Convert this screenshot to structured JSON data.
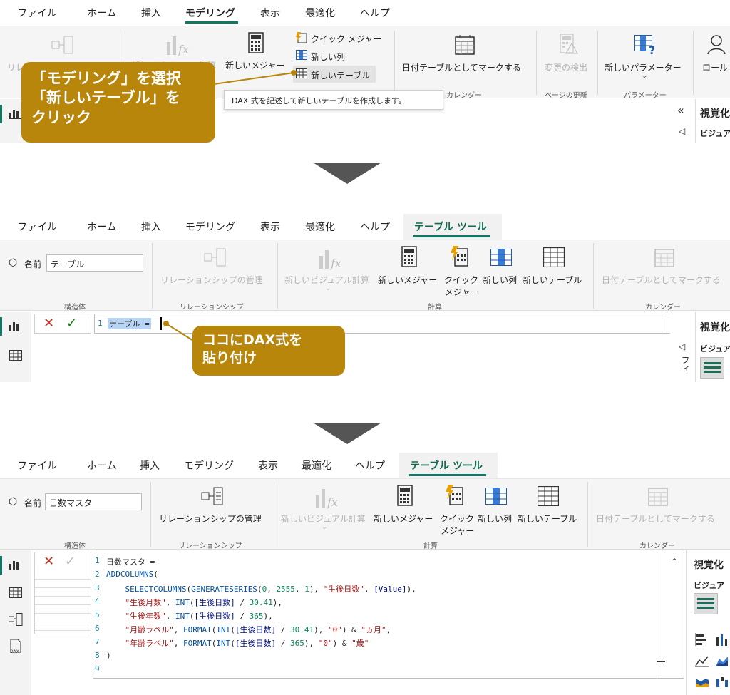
{
  "tabs_1": [
    "ファイル",
    "ホーム",
    "挿入",
    "モデリング",
    "表示",
    "最適化",
    "ヘルプ"
  ],
  "tabs_2": [
    "ファイル",
    "ホーム",
    "挿入",
    "モデリング",
    "表示",
    "最適化",
    "ヘルプ",
    "テーブル ツール"
  ],
  "panel1": {
    "buttons": {
      "relation": "リレ",
      "visual_calc": "新しいビジュアル計算",
      "new_measure": "新しいメジャー",
      "quick_measure": "クイック メジャー",
      "new_column": "新しい列",
      "new_table": "新しいテーブル",
      "mark_date": "日付テーブルとしてマークする",
      "detect_changes": "変更の検出",
      "new_param": "新しいパラメーター",
      "roles": "ロール"
    },
    "groups": {
      "calendar": "カレンダー",
      "page_refresh": "ページの更新",
      "params": "パラメーター"
    },
    "tooltip": "DAX 式を記述して新しいテーブルを作成します。",
    "callout": [
      "「モデリング」を選択",
      "「新しいテーブル」を",
      "クリック"
    ],
    "pane_title": "視覚化",
    "pane_sub": "ビジュア"
  },
  "panel2": {
    "name_label": "名前",
    "name_value": "テーブル",
    "buttons": {
      "relation_mgmt": "リレーションシップの管理",
      "visual_calc": "新しいビジュアル計算",
      "new_measure": "新しいメジャー",
      "quick_measure_1": "クイック",
      "quick_measure_2": "メジャー",
      "new_column": "新しい列",
      "new_table": "新しいテーブル",
      "mark_date": "日付テーブルとしてマークする"
    },
    "groups": {
      "structure": "構造体",
      "relationship": "リレーションシップ",
      "calc": "計算",
      "calendar": "カレンダー"
    },
    "formula_line_no": "1",
    "formula": "テーブル =",
    "callout": [
      "ココにDAX式を",
      "貼り付け"
    ],
    "pane_title": "視覚化",
    "pane_sub": "ビジュア"
  },
  "panel3": {
    "name_label": "名前",
    "name_value": "日数マスタ",
    "buttons": {
      "relation_mgmt": "リレーションシップの管理",
      "visual_calc": "新しいビジュアル計算",
      "new_measure": "新しいメジャー",
      "quick_measure_1": "クイック",
      "quick_measure_2": "メジャー",
      "new_column": "新しい列",
      "new_table": "新しいテーブル",
      "mark_date": "日付テーブルとしてマークする"
    },
    "groups": {
      "structure": "構造体",
      "relationship": "リレーションシップ",
      "calc": "計算",
      "calendar": "カレンダー"
    },
    "code_lines": [
      "日数マスタ =",
      "ADDCOLUMNS(",
      "    SELECTCOLUMNS(GENERATESERIES(0, 2555, 1), \"生後日数\", [Value]),",
      "    \"生後月数\", INT([生後日数] / 30.41),",
      "    \"生後年数\", INT([生後日数] / 365),",
      "    \"月齢ラベル\", FORMAT(INT([生後日数] / 30.41), \"0\") & \"ヵ月\",",
      "    \"年齢ラベル\", FORMAT(INT([生後日数] / 365), \"0\") & \"歳\"",
      ")",
      ""
    ],
    "pane_title": "視覚化",
    "pane_sub": "ビジュア"
  },
  "colors": {
    "accent": "#117865",
    "callout": "#b8860b",
    "arrow": "#555555"
  }
}
